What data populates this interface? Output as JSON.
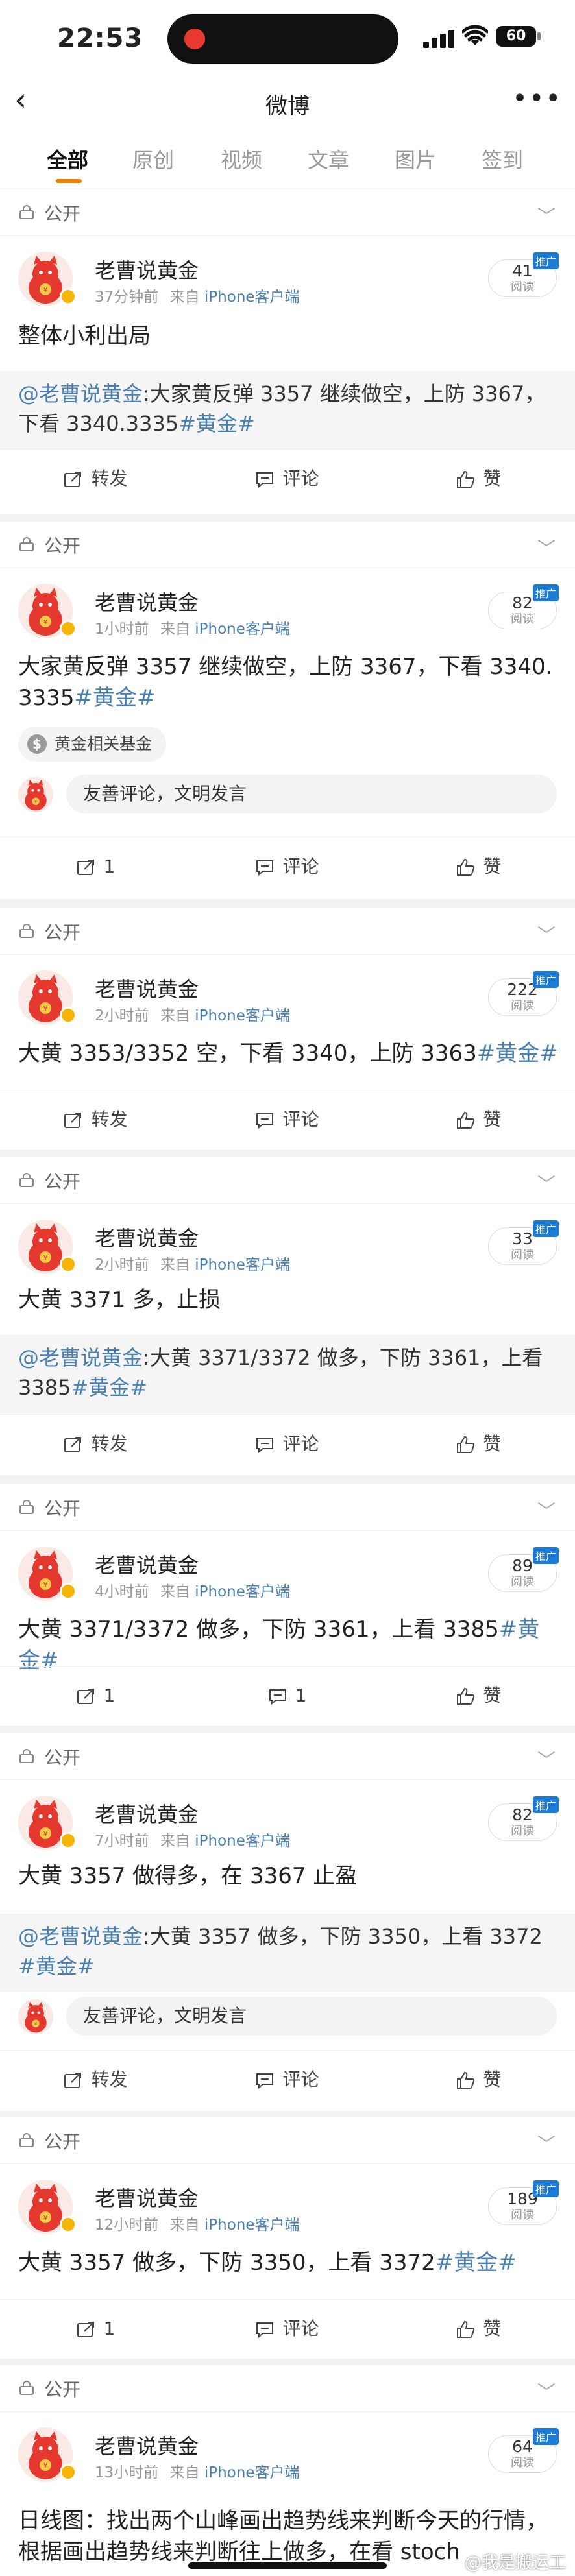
{
  "status_bar": {
    "time": "22:53",
    "battery": "60"
  },
  "nav": {
    "title": "微博"
  },
  "tabs": [
    "全部",
    "原创",
    "视频",
    "文章",
    "图片",
    "签到"
  ],
  "public_label": "公开",
  "author": "老曹说黄金",
  "client_prefix": "来自",
  "client": "iPhone客户端",
  "read_label": "阅读",
  "promo_label": "推广",
  "comment_placeholder": "友善评论，文明发言",
  "chip_label": "黄金相关基金",
  "action_labels": {
    "forward": "转发",
    "comment": "评论",
    "like": "赞"
  },
  "posts": [
    {
      "time": "37分钟前",
      "reads": "41",
      "text": "整体小利出局",
      "tag": "",
      "repost_user": "@老曹说黄金",
      "repost_text": ":大家黄反弹 3357 继续做空，上防 3367，下看 3340.3335",
      "repost_tag": "#黄金#",
      "forward": "转发",
      "comment": "评论",
      "like": "赞"
    },
    {
      "time": "1小时前",
      "reads": "82",
      "text": "大家黄反弹 3357 继续做空，上防 3367，下看 3340.3335",
      "tag": "#黄金#",
      "forward": "1",
      "comment": "评论",
      "like": "赞"
    },
    {
      "time": "2小时前",
      "reads": "222",
      "text": "大黄 3353/3352 空，下看 3340，上防 3363",
      "tag": "#黄金#",
      "forward": "转发",
      "comment": "评论",
      "like": "赞"
    },
    {
      "time": "2小时前",
      "reads": "33",
      "text": "大黄 3371 多，止损",
      "tag": "",
      "repost_user": "@老曹说黄金",
      "repost_text": ":大黄 3371/3372 做多，下防 3361，上看 3385",
      "repost_tag": "#黄金#",
      "forward": "转发",
      "comment": "评论",
      "like": "赞"
    },
    {
      "time": "4小时前",
      "reads": "89",
      "text": "大黄 3371/3372 做多，下防 3361，上看 3385",
      "tag": "#黄金#",
      "forward": "1",
      "comment": "1",
      "like": "赞"
    },
    {
      "time": "7小时前",
      "reads": "82",
      "text": "大黄 3357 做得多，在 3367 止盈",
      "tag": "",
      "repost_user": "@老曹说黄金",
      "repost_text": ":大黄 3357 做多，下防 3350，上看 3372",
      "repost_tag": "#黄金#",
      "forward": "转发",
      "comment": "评论",
      "like": "赞"
    },
    {
      "time": "12小时前",
      "reads": "189",
      "text": "大黄 3357 做多，下防 3350，上看 3372",
      "tag": "#黄金#",
      "forward": "1",
      "comment": "评论",
      "like": "赞"
    },
    {
      "time": "13小时前",
      "reads": "64",
      "text": "日线图：找出两个山峰画出趋势线来判断今天的行情，根据画出趋势线来判断往上做多，在看 stoch",
      "tag": ""
    }
  ],
  "watermark": "@我是搬运工"
}
